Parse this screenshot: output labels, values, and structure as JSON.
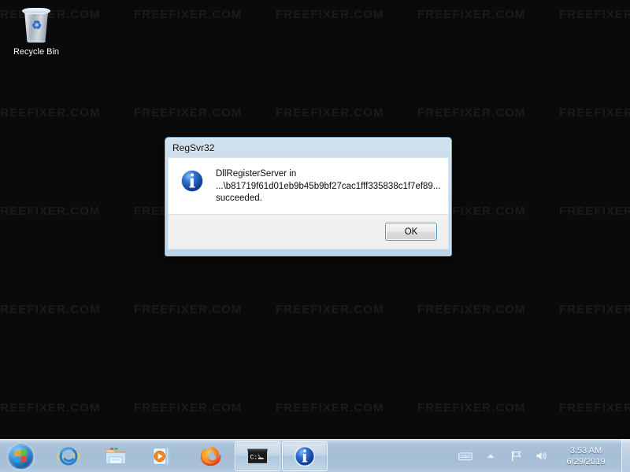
{
  "desktop": {
    "background_color": "#0a0a0a",
    "watermark_text": "FREEFIXER.COM",
    "icons": [
      {
        "name": "recycle-bin",
        "label": "Recycle Bin"
      }
    ]
  },
  "dialog": {
    "title": "RegSvr32",
    "icon": "info-icon",
    "message_lines": [
      "DllRegisterServer in",
      "...\\b81719f61d01eb9b45b9bf27cac1fff335838c1f7ef89...",
      "succeeded."
    ],
    "buttons": [
      {
        "name": "ok-button",
        "label": "OK",
        "focused": true
      }
    ],
    "accent_color": "#4a9fd4"
  },
  "taskbar": {
    "start_button": {
      "label": "Start",
      "icon": "windows-orb-icon"
    },
    "buttons": [
      {
        "name": "internet-explorer",
        "label": "Internet Explorer",
        "icon": "internet-explorer-icon",
        "active": false
      },
      {
        "name": "windows-explorer",
        "label": "Windows Explorer",
        "icon": "folder-icon",
        "active": false
      },
      {
        "name": "windows-media-player",
        "label": "Windows Media Player",
        "icon": "media-player-icon",
        "active": false
      },
      {
        "name": "firefox",
        "label": "Mozilla Firefox",
        "icon": "firefox-icon",
        "active": false
      },
      {
        "name": "command-prompt",
        "label": "Command Prompt",
        "icon": "command-prompt-icon",
        "active": true
      },
      {
        "name": "regsvr32-dialog",
        "label": "RegSvr32",
        "icon": "info-icon",
        "active": true
      }
    ],
    "tray": {
      "icons": [
        {
          "name": "keyboard-icon",
          "label": "Keyboard"
        },
        {
          "name": "show-hidden-icons-icon",
          "label": "Show hidden icons"
        },
        {
          "name": "action-center-flag-icon",
          "label": "Action Center"
        },
        {
          "name": "volume-speaker-icon",
          "label": "Volume"
        }
      ],
      "clock": {
        "time": "3:53 AM",
        "date": "6/29/2019"
      },
      "show_desktop": {
        "label": "Show desktop"
      }
    },
    "background_color": "#a5bed6"
  }
}
